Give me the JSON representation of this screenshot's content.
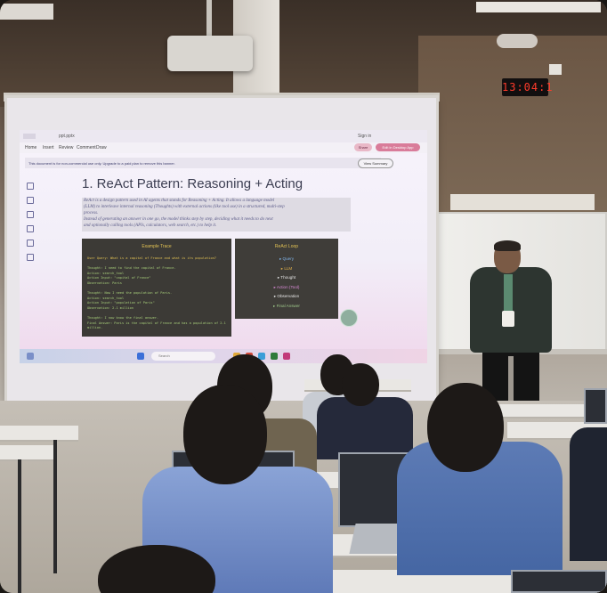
{
  "room": {
    "wall_clock": "13:04:1",
    "palette": {
      "ceiling": "#3a2f27",
      "wall": "#7c6c5e",
      "screen_glow": "#f2eef8",
      "slide_panel": "#3c3a36",
      "panel_heading": "#e2c254",
      "code_text": "#a8cf7b",
      "shirt_blue": "#5d7bb5",
      "lanyard_green": "#5b8a70",
      "clock_digits": "#ff3b2b"
    }
  },
  "projected_screen": {
    "browser": {
      "tab_label": "ppt.pptx",
      "menu": [
        "Home",
        "Insert",
        "Review",
        "Comment",
        "Draw"
      ],
      "infobar_text": "This document is for non-commercial use only. Upgrade to a paid plan to remove this banner.",
      "right_buttons": [
        "Sign in",
        "Share",
        "Edit in Desktop App"
      ],
      "infobar_button": "View Summary"
    },
    "slide": {
      "title": "1. ReAct Pattern: Reasoning + Acting",
      "paragraph_line1": "ReAct is a design pattern used in AI agents that stands for Reasoning + Acting. It allows a language model",
      "paragraph_line2": "(LLM) to interleave internal reasoning (Thoughts) with external actions (like tool use) in a structured, multi-step",
      "paragraph_line3": "process.",
      "paragraph_line4": "Instead of generating an answer in one go, the model thinks step by step, deciding what it needs to do next",
      "paragraph_line5": "and optionally calling tools (APIs, calculators, web search, etc.) to help it.",
      "trace_panel": {
        "title": "Example Trace",
        "lines": [
          "User Query: What is a capital of France and what is its population?",
          "",
          "Thought: I need to find the capital of France.",
          "Action: search_tool",
          "Action Input: \"capital of France\"",
          "Observation: Paris",
          "",
          "Thought: Now I need the population of Paris.",
          "Action: search_tool",
          "Action Input: \"population of Paris\"",
          "Observation: 2.1 million",
          "",
          "Thought: I now know the final answer.",
          "Final Answer: Paris is the capital of France and has a population of 2.1",
          "million."
        ]
      },
      "loop_panel": {
        "title": "ReAct Loop",
        "items": [
          {
            "label": "Query",
            "color": "#7fb3e8"
          },
          {
            "label": "LLM",
            "color": "#e2b24a"
          },
          {
            "label": "Thought",
            "color": "#e6e6e6"
          },
          {
            "label": "Action (Tool)",
            "color": "#d98ad6"
          },
          {
            "label": "Observation",
            "color": "#e6e6e6"
          },
          {
            "label": "Final Answer",
            "color": "#9fc98a"
          }
        ]
      }
    },
    "taskbar": {
      "search_placeholder": "Search"
    }
  }
}
